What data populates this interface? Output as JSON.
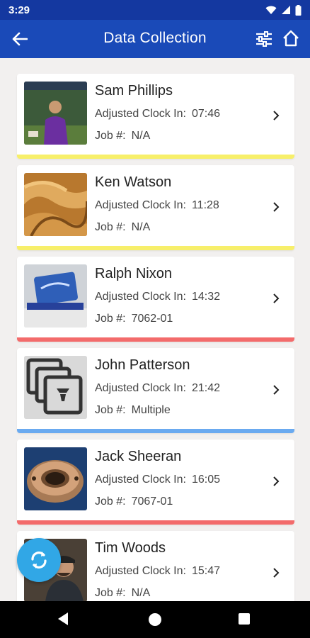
{
  "status_bar": {
    "time": "3:29"
  },
  "app_bar": {
    "title": "Data Collection"
  },
  "employees": [
    {
      "name": "Sam Phillips",
      "clock_label": "Adjusted Clock In:",
      "clock_time": "07:46",
      "job_label": "Job #:",
      "job_value": "N/A",
      "status_color": "#f7ef6a",
      "thumbnail": "person-photo"
    },
    {
      "name": "Ken Watson",
      "clock_label": "Adjusted Clock In:",
      "clock_time": "11:28",
      "job_label": "Job #:",
      "job_value": "N/A",
      "status_color": "#f7ef6a",
      "thumbnail": "wood-swirl"
    },
    {
      "name": "Ralph Nixon",
      "clock_label": "Adjusted Clock In:",
      "clock_time": "14:32",
      "job_label": "Job #:",
      "job_value": "7062-01",
      "status_color": "#f36b6b",
      "thumbnail": "blue-tag"
    },
    {
      "name": "John Patterson",
      "clock_label": "Adjusted Clock In:",
      "clock_time": "21:42",
      "job_label": "Job #:",
      "job_value": "Multiple",
      "status_color": "#6aaaf0",
      "thumbnail": "multiple-jobs-icon"
    },
    {
      "name": "Jack Sheeran",
      "clock_label": "Adjusted Clock In:",
      "clock_time": "16:05",
      "job_label": "Job #:",
      "job_value": "7067-01",
      "status_color": "#f36b6b",
      "thumbnail": "metal-flange"
    },
    {
      "name": "Tim Woods",
      "clock_label": "Adjusted Clock In:",
      "clock_time": "15:47",
      "job_label": "Job #:",
      "job_value": "N/A",
      "status_color": "#f7ef6a",
      "thumbnail": "person-photo"
    }
  ],
  "colors": {
    "app_bar": "#1a4ab8",
    "status_bar": "#1438a0",
    "fab": "#31a7e6",
    "background": "#f2f0ef"
  }
}
